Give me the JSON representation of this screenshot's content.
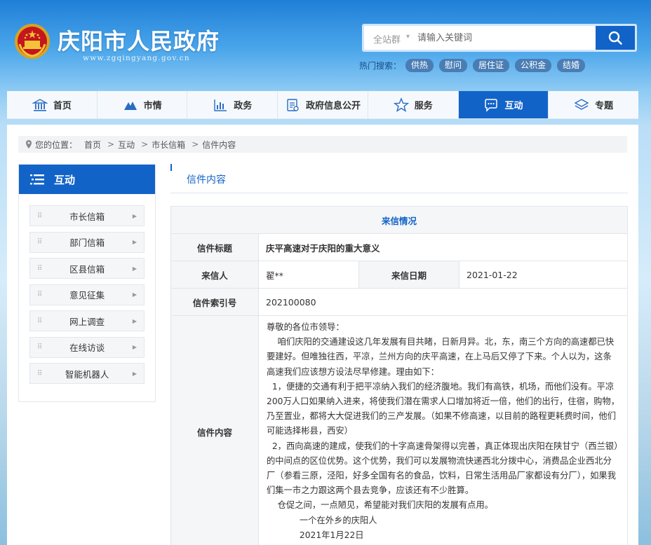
{
  "header": {
    "title": "庆阳市人民政府",
    "domain": "www.zgqingyang.gov.cn"
  },
  "search": {
    "scope": "全站群",
    "placeholder": "请输入关键词",
    "hot_label": "热门搜索：",
    "hot_tags": [
      "供热",
      "慰问",
      "居住证",
      "公积金",
      "结婚"
    ]
  },
  "nav": {
    "items": [
      {
        "label": "首页",
        "icon": "museum-icon"
      },
      {
        "label": "市情",
        "icon": "mountain-icon"
      },
      {
        "label": "政务",
        "icon": "chart-icon"
      },
      {
        "label": "政府信息公开",
        "icon": "document-icon"
      },
      {
        "label": "服务",
        "icon": "star-icon"
      },
      {
        "label": "互动",
        "icon": "chat-icon"
      },
      {
        "label": "专题",
        "icon": "layers-icon"
      }
    ],
    "active": "互动"
  },
  "breadcrumb": {
    "prefix": "您的位置：",
    "items": [
      "首页",
      "互动",
      "市长信箱",
      "信件内容"
    ]
  },
  "sidebar": {
    "title": "互动",
    "items": [
      "市长信箱",
      "部门信箱",
      "区县信箱",
      "意见征集",
      "网上调查",
      "在线访谈",
      "智能机器人"
    ]
  },
  "content": {
    "title": "信件内容",
    "section": "来信情况",
    "subject_label": "信件标题",
    "subject": "庆平高速对于庆阳的重大意义",
    "sender_label": "来信人",
    "sender": "翟**",
    "date_label": "来信日期",
    "date": "2021-01-22",
    "index_label": "信件索引号",
    "index": "202100080",
    "body_label": "信件内容",
    "body": [
      "尊敬的各位市领导：",
      "    咱们庆阳的交通建设这几年发展有目共睹，日新月异。北，东，南三个方向的高速都已快要建好。但唯独往西，平凉，兰州方向的庆平高速，在上马后又停了下来。个人以为，这条高速我们应该想方设法尽早修建。理由如下：",
      "  1，便捷的交通有利于把平凉纳入我们的经济腹地。我们有高铁，机场，而他们没有。平凉200万人口如果纳入进来，将使我们潜在需求人口增加将近一倍，他们的出行，住宿，购物，乃至置业，都将大大促进我们的三产发展。（如果不修高速，以目前的路程更耗费时间，他们可能选择彬县，西安）",
      "  2，西向高速的建成，使我们的十字高速骨架得以完善，真正体现出庆阳在陕甘宁（西兰银）的中间点的区位优势。这个优势，我们可以发展物流快递西北分拨中心，消费品企业西北分厂（参看三原，泾阳，好多全国有名的食品，饮料，日常生活用品厂家都设有分厂），如果我们集一市之力跟这两个县去竞争，应该还有不少胜算。",
      "    仓促之间，一点陋见，希望能对我们庆阳的发展有点用。",
      "            一个在外乡的庆阳人",
      "            2021年1月22日"
    ]
  },
  "colors": {
    "primary": "#1263c8",
    "header_top": "#1f7fd8",
    "label_bg": "#f4f6f8"
  }
}
